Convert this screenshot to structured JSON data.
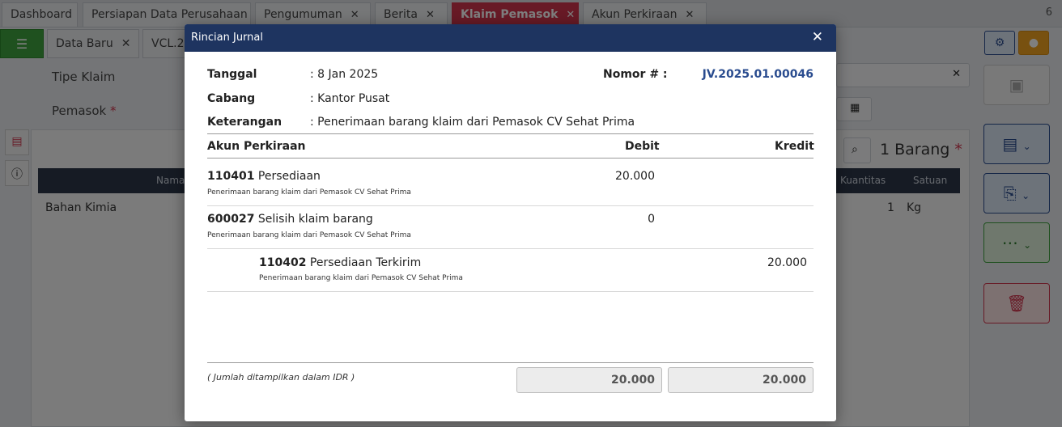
{
  "tabs": [
    {
      "label": "Dashboard",
      "closable": false,
      "active": false
    },
    {
      "label": "Persiapan Data Perusahaan",
      "closable": false,
      "active": false
    },
    {
      "label": "Pengumuman",
      "closable": true,
      "active": false
    },
    {
      "label": "Berita",
      "closable": true,
      "active": false
    },
    {
      "label": "Klaim Pemasok",
      "closable": true,
      "active": true
    },
    {
      "label": "Akun Perkiraan",
      "closable": true,
      "active": false
    }
  ],
  "tab_count": "6",
  "subtabs": [
    {
      "label": "Data Baru"
    },
    {
      "label": "VCL.2"
    }
  ],
  "form": {
    "tipe_klaim_label": "Tipe Klaim",
    "pemasok_label": "Pemasok",
    "required_mark": "*"
  },
  "items_panel": {
    "count_label": "1 Barang",
    "headers": {
      "nama": "Nama",
      "kuantitas": "Kuantitas",
      "satuan": "Satuan"
    },
    "rows": [
      {
        "nama": "Bahan Kimia",
        "kuantitas": "1",
        "satuan": "Kg"
      }
    ]
  },
  "modal": {
    "title": "Rincian Jurnal",
    "close_glyph": "✕",
    "tanggal_label": "Tanggal",
    "tanggal_value": ": 8 Jan 2025",
    "cabang_label": "Cabang",
    "cabang_value": ": Kantor Pusat",
    "keterangan_label": "Keterangan",
    "keterangan_value": ": Penerimaan barang klaim dari Pemasok CV Sehat Prima",
    "nomor_label": "Nomor # :",
    "nomor_value": "JV.2025.01.00046",
    "columns": {
      "akun": "Akun Perkiraan",
      "debit": "Debit",
      "kredit": "Kredit"
    },
    "entries": [
      {
        "code": "110401",
        "name": "Persediaan",
        "desc": "Penerimaan barang klaim dari Pemasok CV Sehat Prima",
        "debit": "20.000",
        "kredit": ""
      },
      {
        "code": "600027",
        "name": "Selisih klaim barang",
        "desc": "Penerimaan barang klaim dari Pemasok CV Sehat Prima",
        "debit": "0",
        "kredit": ""
      },
      {
        "code": "110402",
        "name": "Persediaan Terkirim",
        "desc": "Penerimaan barang klaim dari Pemasok CV Sehat Prima",
        "debit": "",
        "kredit": "20.000"
      }
    ],
    "footnote": "( Jumlah ditampilkan dalam IDR )",
    "total_debit": "20.000",
    "total_kredit": "20.000"
  },
  "colors": {
    "active_tab": "#d0344d",
    "modal_header": "#1e3460",
    "journal_number": "#2a4c8f",
    "menu_green": "#3fa33f"
  }
}
